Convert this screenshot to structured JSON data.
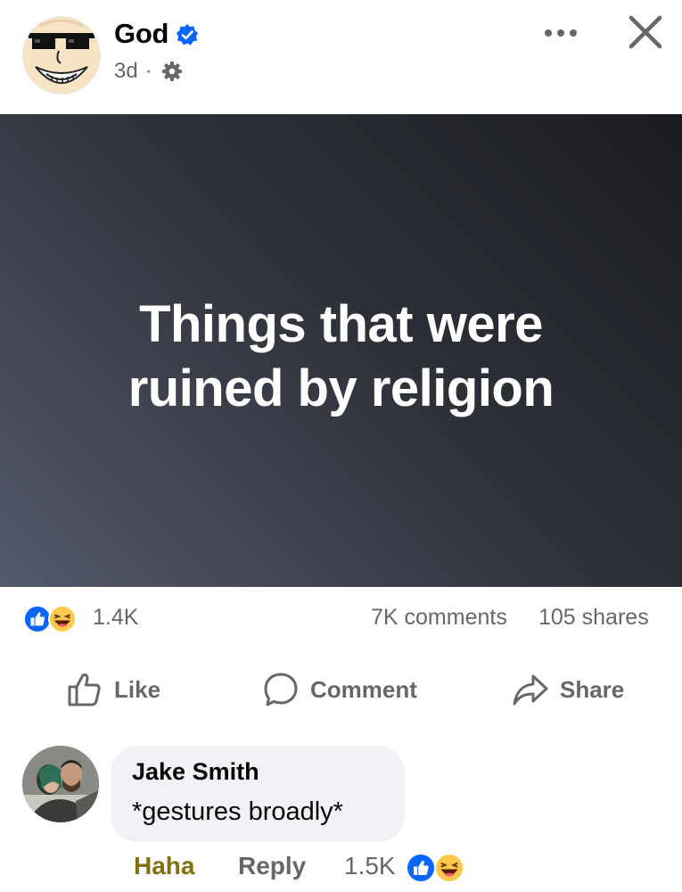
{
  "post": {
    "author": "God",
    "time": "3d",
    "separator": "·",
    "image_text_line1": "Things that were",
    "image_text_line2": "ruined by religion"
  },
  "icons": {
    "verified": "verified-badge-icon",
    "privacy": "gear-icon",
    "more": "more-dots-icon",
    "close": "close-icon"
  },
  "stats": {
    "reactions_count": "1.4K",
    "comments": "7K comments",
    "shares": "105 shares"
  },
  "actions": {
    "like": "Like",
    "comment": "Comment",
    "share": "Share"
  },
  "comment": {
    "name": "Jake Smith",
    "text": "*gestures broadly*",
    "reaction_label": "Haha",
    "reply_label": "Reply",
    "reactions_count": "1.5K"
  },
  "colors": {
    "facebook_blue": "#0866ff",
    "haha_label": "#81700e",
    "secondary_text": "#65676b",
    "bubble_bg": "#f0f2f5"
  }
}
